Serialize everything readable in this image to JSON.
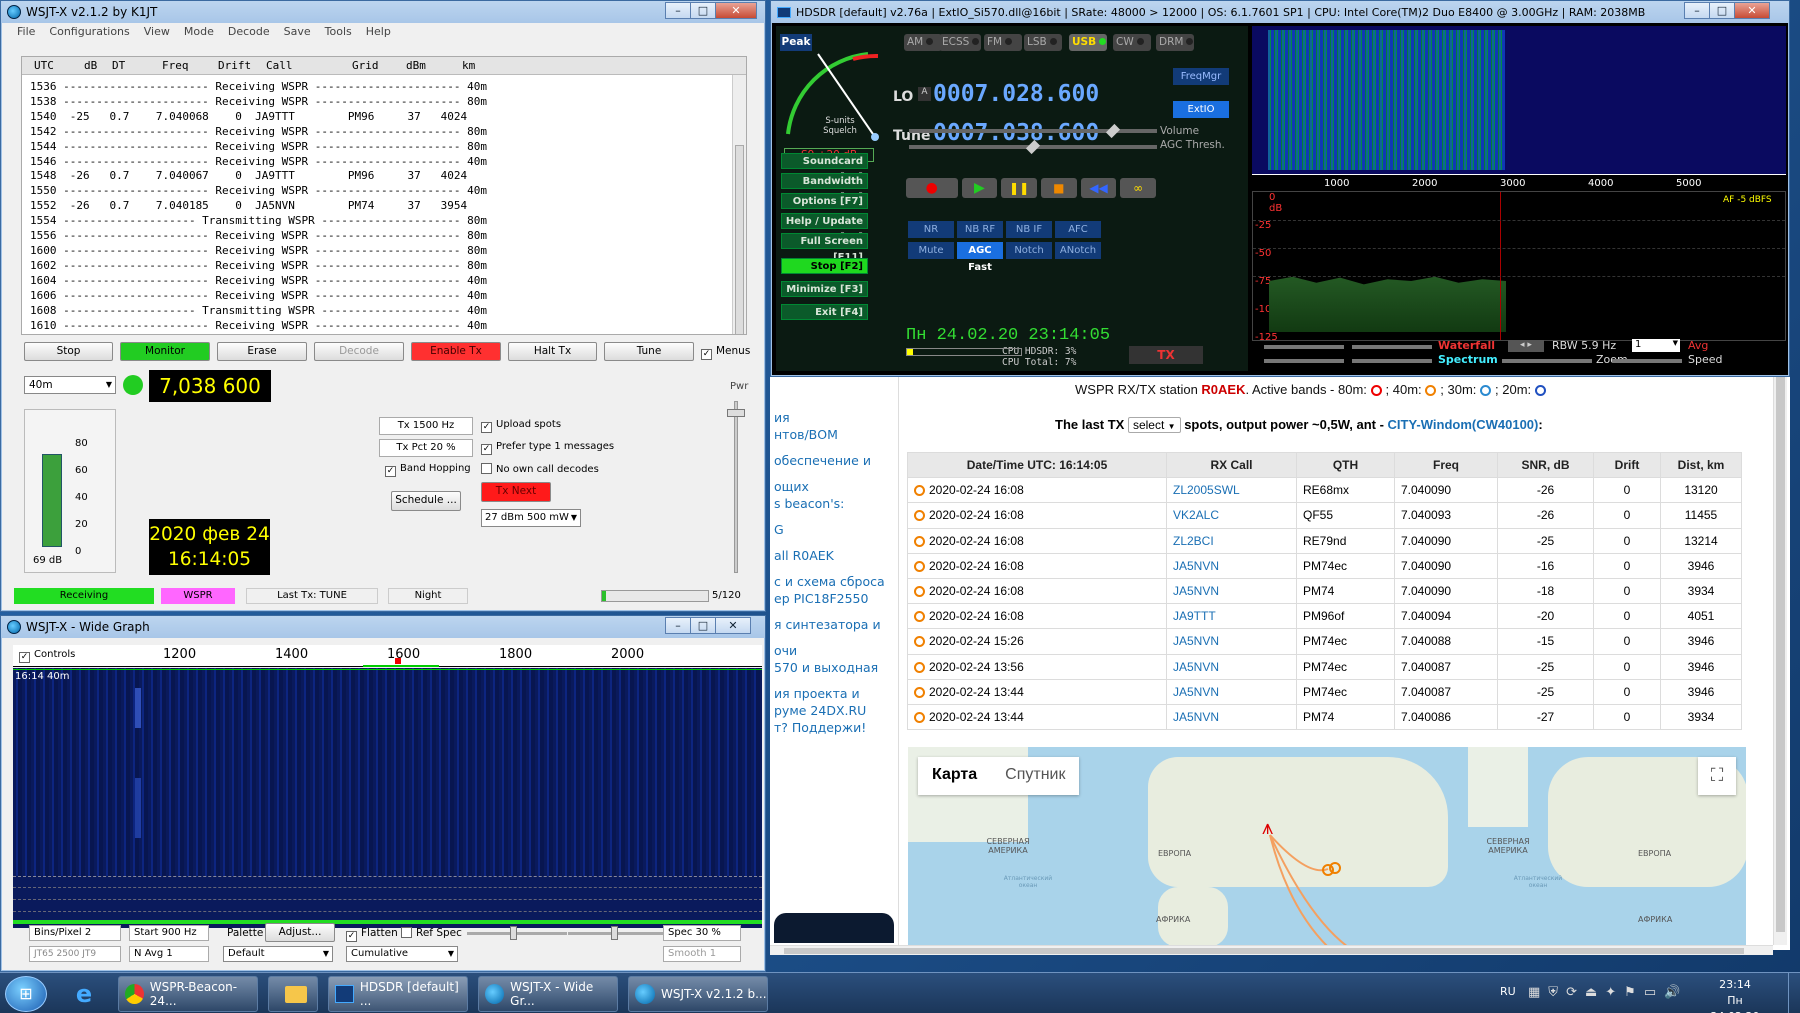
{
  "wsjtx": {
    "title": "WSJT-X   v2.1.2   by K1JT",
    "menu": [
      "File",
      "Configurations",
      "View",
      "Mode",
      "Decode",
      "Save",
      "Tools",
      "Help"
    ],
    "headers": [
      "UTC",
      "dB",
      "DT",
      "Freq",
      "Drift",
      "Call",
      "Grid",
      "dBm",
      "km"
    ],
    "rows": [
      "1536 ---------------------- Receiving WSPR ---------------------- 40m",
      "1538 ---------------------- Receiving WSPR ---------------------- 80m",
      "1540  -25   0.7    7.040068    0  JA9TTT        PM96     37   4024",
      "1542 ---------------------- Receiving WSPR ---------------------- 80m",
      "1544 ---------------------- Receiving WSPR ---------------------- 80m",
      "1546 ---------------------- Receiving WSPR ---------------------- 40m",
      "1548  -26   0.7    7.040067    0  JA9TTT        PM96     37   4024",
      "1550 ---------------------- Receiving WSPR ---------------------- 40m",
      "1552  -26   0.7    7.040185    0  JA5NVN        PM74     37   3954",
      "1554 -------------------- Transmitting WSPR --------------------- 80m",
      "1556 ---------------------- Receiving WSPR ---------------------- 80m",
      "1600 ---------------------- Receiving WSPR ---------------------- 80m",
      "1602 ---------------------- Receiving WSPR ---------------------- 80m",
      "1604 ---------------------- Receiving WSPR ---------------------- 40m",
      "1606 ---------------------- Receiving WSPR ---------------------- 40m",
      "1608 -------------------- Transmitting WSPR --------------------- 40m",
      "1610 ---------------------- Receiving WSPR ---------------------- 40m"
    ],
    "buttons": {
      "stop": "Stop",
      "monitor": "Monitor",
      "erase": "Erase",
      "decode": "Decode",
      "enable_tx": "Enable Tx",
      "halt_tx": "Halt Tx",
      "tune": "Tune",
      "menus": "Menus"
    },
    "band": "40m",
    "freq": "7,038 600",
    "pwr": "Pwr",
    "meter_ticks": [
      "80",
      "60",
      "40",
      "20",
      "0"
    ],
    "meter_db": "69 dB",
    "meter_level_db": 69,
    "datetime_line1": "2020 фев 24",
    "datetime_line2": "16:14:05",
    "tx_freq": "Tx  1500  Hz",
    "tx_pct": "Tx Pct  20  %",
    "upload_spots": "Upload spots",
    "prefer_type1": "Prefer type 1 messages",
    "band_hopping": "Band Hopping",
    "no_own_call": "No own call decodes",
    "schedule": "Schedule ...",
    "tx_next": "Tx Next",
    "power_sel": "27 dBm  500 mW",
    "status": {
      "receiving": "Receiving",
      "mode": "WSPR",
      "last_tx": "Last Tx: TUNE",
      "night": "Night",
      "progress": "5/120",
      "progress_value": 5,
      "progress_max": 120
    }
  },
  "widegraph": {
    "title": "WSJT-X - Wide Graph",
    "controls": "Controls",
    "scale": [
      "1200",
      "1400",
      "1600",
      "1800",
      "2000"
    ],
    "time_label": "16:14   40m",
    "bins_label": "Bins/Pixel  2",
    "start_label": "Start  900 Hz",
    "palette": "Palette",
    "adjust": "Adjust...",
    "flatten": "Flatten",
    "ref_spec": "Ref Spec",
    "spec": "Spec  30 %",
    "mode_sel": "JT65   2500   JT9",
    "navg": "N Avg  1",
    "default": "Default",
    "cumulative": "Cumulative",
    "smooth": "Smooth  1"
  },
  "hdsdr": {
    "title": "HDSDR  [default]   v2.76a   |   ExtIO_Si570.dll@16bit   |   SRate: 48000 > 12000   |   OS: 6.1.7601 SP1   |   CPU: Intel Core(TM)2 Duo      E8400  @ 3.00GHz   |   RAM: 2038MB",
    "peak": "Peak",
    "smeter_label": "S-units Squelch",
    "smeter_ticks": [
      "1",
      "3",
      "5",
      "7",
      "9",
      "+20",
      "+40"
    ],
    "smeter_value": "S9 +20 dB",
    "modes": [
      "AM",
      "ECSS",
      "FM",
      "LSB",
      "USB",
      "CW",
      "DRM"
    ],
    "active_mode": "USB",
    "lo_label": "LO",
    "lo_freq": "0007.028.600",
    "tune_label": "Tune",
    "tune_freq": "0007.038.600",
    "freqmgr": "FreqMgr",
    "extio": "ExtIO",
    "volume": "Volume",
    "agc_thresh": "AGC Thresh.",
    "side_buttons": [
      "Soundcard  [F5]",
      "Bandwidth  [F6]",
      "Options   [F7]",
      "Help / Update  [F1]",
      "Full Screen  [F11]",
      "Stop   [F2]",
      "Minimize  [F3]",
      "Exit   [F4]"
    ],
    "dsp_row1": [
      "NR",
      "NB RF",
      "NB IF",
      "AFC"
    ],
    "dsp_row2": [
      "Mute",
      "AGC Fast",
      "Notch",
      "ANotch"
    ],
    "clock": "Пн 24.02.20 23:14:05",
    "cpu_hdsdr": "CPU HDSDR: 3%",
    "cpu_total": "CPU Total: 7%",
    "tx": "TX",
    "wf_scale": [
      "1000",
      "2000",
      "3000",
      "4000",
      "5000"
    ],
    "spec_ticks": [
      "0 dB",
      "-25",
      "-50",
      "-75",
      "-100",
      "-125"
    ],
    "af": "AF -5 dBFS",
    "waterfall": "Waterfall",
    "spectrum": "Spectrum",
    "rbw": "RBW  5.9 Hz",
    "zoom": "Zoom",
    "avg_sel": "1",
    "avg": "Avg",
    "speed": "Speed"
  },
  "web": {
    "station_prefix": "WSPR RX/TX station ",
    "station_call": "R0AEK",
    "active_bands": ". Active bands - 80m: ",
    "band_40": "; 40m: ",
    "band_30": "; 30m: ",
    "band_20": "; 20m: ",
    "last_tx_prefix": "The last TX ",
    "select": "select",
    "last_tx_suffix": " spots, output power ~0,5W, ant - ",
    "antenna": "CITY-Windom(CW40100)",
    "colon": ":",
    "side_links": [
      "ия",
      "нтов/ВОМ",
      "обеспечение  и",
      "ощих",
      "s beacon's:",
      "G",
      "all R0AEK",
      "с и схема сброса",
      "ер PIC18F2550",
      "я синтезатора и",
      "очи",
      "570 и выходная",
      "ия проекта и",
      "руме 24DX.RU",
      "т? Поддержи!"
    ],
    "table_headers": [
      "Date/Time UTC: 16:14:05",
      "RX Call",
      "QTH",
      "Freq",
      "SNR, dB",
      "Drift",
      "Dist, km"
    ],
    "spots": [
      [
        "2020-02-24 16:08",
        "ZL2005SWL",
        "RE68mx",
        "7.040090",
        "-26",
        "0",
        "13120"
      ],
      [
        "2020-02-24 16:08",
        "VK2ALC",
        "QF55",
        "7.040093",
        "-26",
        "0",
        "11455"
      ],
      [
        "2020-02-24 16:08",
        "ZL2BCI",
        "RE79nd",
        "7.040090",
        "-25",
        "0",
        "13214"
      ],
      [
        "2020-02-24 16:08",
        "JA5NVN",
        "PM74ec",
        "7.040090",
        "-16",
        "0",
        "3946"
      ],
      [
        "2020-02-24 16:08",
        "JA5NVN",
        "PM74",
        "7.040090",
        "-18",
        "0",
        "3934"
      ],
      [
        "2020-02-24 16:08",
        "JA9TTT",
        "PM96of",
        "7.040094",
        "-20",
        "0",
        "4051"
      ],
      [
        "2020-02-24 15:26",
        "JA5NVN",
        "PM74ec",
        "7.040088",
        "-15",
        "0",
        "3946"
      ],
      [
        "2020-02-24 13:56",
        "JA5NVN",
        "PM74ec",
        "7.040087",
        "-25",
        "0",
        "3946"
      ],
      [
        "2020-02-24 13:44",
        "JA5NVN",
        "PM74ec",
        "7.040087",
        "-25",
        "0",
        "3946"
      ],
      [
        "2020-02-24 13:44",
        "JA5NVN",
        "PM74",
        "7.040086",
        "-27",
        "0",
        "3934"
      ]
    ],
    "map_tab1": "Карта",
    "map_tab2": "Спутник",
    "map_labels": [
      "СЕВЕРНАЯ АМЕРИКА",
      "ЕВРОПА",
      "АФРИКА",
      "СЕВЕРНАЯ АМЕРИКА",
      "ЕВРОПА",
      "АФРИКА",
      "Атлантический океан",
      "Атлантический океан"
    ]
  },
  "taskbar": {
    "tasks": [
      "WSPR-Beacon-24...",
      "HDSDR [default] ...",
      "WSJT-X - Wide Gr...",
      "WSJT-X   v2.1.2   b..."
    ],
    "lang": "RU",
    "time": "23:14",
    "date": "Пн 24.02.20"
  },
  "colors": {
    "monitor": "#22cc22",
    "enable_tx": "#ff3030",
    "receiving": "#22dd22",
    "wspr": "#ff66ff",
    "hdsdr_bg": "#000000",
    "accent": "#1a6fb4"
  }
}
